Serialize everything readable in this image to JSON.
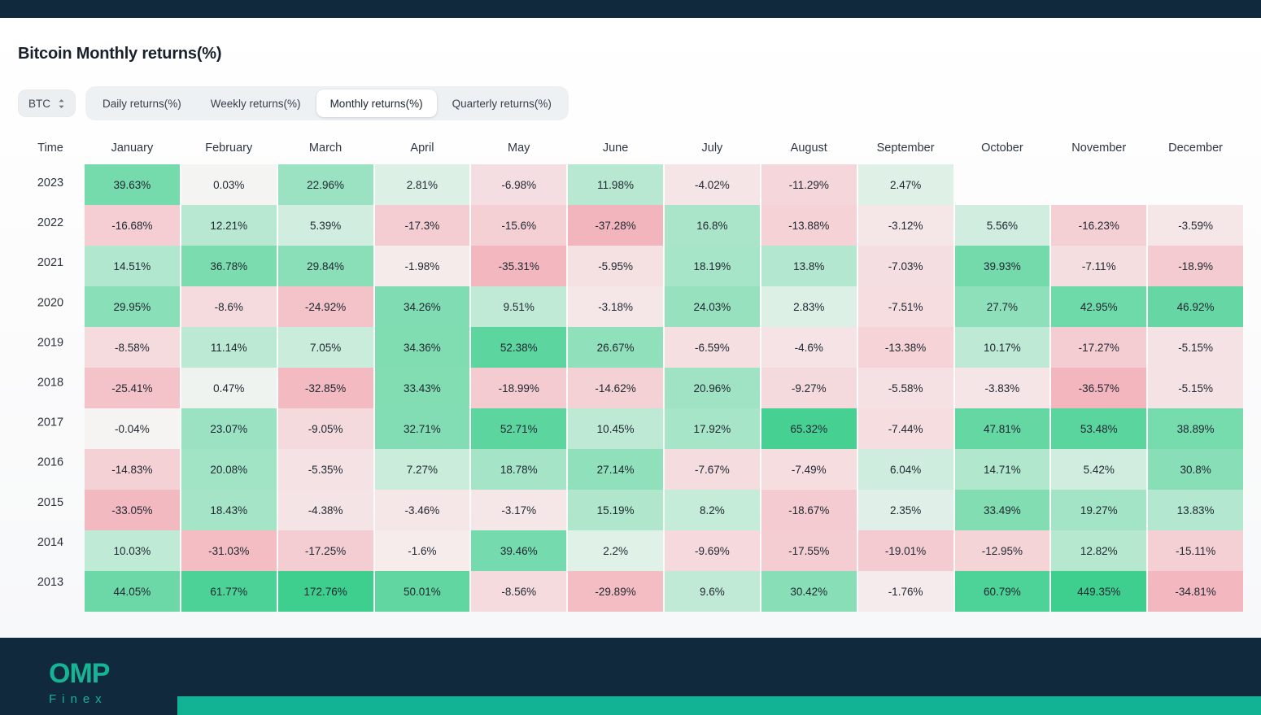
{
  "header": {
    "title": "Bitcoin Monthly returns(%)"
  },
  "controls": {
    "symbol": "BTC",
    "symbol_icon": "chevron-up-down-icon",
    "tabs": [
      {
        "label": "Daily returns(%)",
        "active": false
      },
      {
        "label": "Weekly returns(%)",
        "active": false
      },
      {
        "label": "Monthly returns(%)",
        "active": true
      },
      {
        "label": "Quarterly returns(%)",
        "active": false
      }
    ]
  },
  "colors": {
    "topbar": "#10293d",
    "footer": "#10293d",
    "accent": "#12b394",
    "positive_max": "#3ecf8e",
    "negative_max": "#f3a8b1",
    "neutral": "#f5f4f3",
    "tab_track": "#eef1f4",
    "tab_active": "#ffffff"
  },
  "footer": {
    "logo_primary": "OMP",
    "logo_secondary": "Finex"
  },
  "chart_data": {
    "type": "heatmap",
    "title": "Bitcoin Monthly returns(%)",
    "xlabel": "",
    "ylabel": "Time",
    "row_header": "Time",
    "categories": [
      "January",
      "February",
      "March",
      "April",
      "May",
      "June",
      "July",
      "August",
      "September",
      "October",
      "November",
      "December"
    ],
    "rows": [
      "2023",
      "2022",
      "2021",
      "2020",
      "2019",
      "2018",
      "2017",
      "2016",
      "2015",
      "2014",
      "2013"
    ],
    "unit": "%",
    "values": [
      [
        39.63,
        0.03,
        22.96,
        2.81,
        -6.98,
        11.98,
        -4.02,
        -11.29,
        2.47,
        null,
        null,
        null
      ],
      [
        -16.68,
        12.21,
        5.39,
        -17.3,
        -15.6,
        -37.28,
        16.8,
        -13.88,
        -3.12,
        5.56,
        -16.23,
        -3.59
      ],
      [
        14.51,
        36.78,
        29.84,
        -1.98,
        -35.31,
        -5.95,
        18.19,
        13.8,
        -7.03,
        39.93,
        -7.11,
        -18.9
      ],
      [
        29.95,
        -8.6,
        -24.92,
        34.26,
        9.51,
        -3.18,
        24.03,
        2.83,
        -7.51,
        27.7,
        42.95,
        46.92
      ],
      [
        -8.58,
        11.14,
        7.05,
        34.36,
        52.38,
        26.67,
        -6.59,
        -4.6,
        -13.38,
        10.17,
        -17.27,
        -5.15
      ],
      [
        -25.41,
        0.47,
        -32.85,
        33.43,
        -18.99,
        -14.62,
        20.96,
        -9.27,
        -5.58,
        -3.83,
        -36.57,
        -5.15
      ],
      [
        -0.04,
        23.07,
        -9.05,
        32.71,
        52.71,
        10.45,
        17.92,
        65.32,
        -7.44,
        47.81,
        53.48,
        38.89
      ],
      [
        -14.83,
        20.08,
        -5.35,
        7.27,
        18.78,
        27.14,
        -7.67,
        -7.49,
        6.04,
        14.71,
        5.42,
        30.8
      ],
      [
        -33.05,
        18.43,
        -4.38,
        -3.46,
        -3.17,
        15.19,
        8.2,
        -18.67,
        2.35,
        33.49,
        19.27,
        13.83
      ],
      [
        10.03,
        -31.03,
        -17.25,
        -1.6,
        39.46,
        2.2,
        -9.69,
        -17.55,
        -19.01,
        -12.95,
        12.82,
        -15.11
      ],
      [
        44.05,
        61.77,
        172.76,
        50.01,
        -8.56,
        -29.89,
        9.6,
        30.42,
        -1.76,
        60.79,
        449.35,
        -34.81
      ]
    ],
    "labels": [
      [
        "39.63%",
        "0.03%",
        "22.96%",
        "2.81%",
        "-6.98%",
        "11.98%",
        "-4.02%",
        "-11.29%",
        "2.47%",
        "",
        "",
        ""
      ],
      [
        "-16.68%",
        "12.21%",
        "5.39%",
        "-17.3%",
        "-15.6%",
        "-37.28%",
        "16.8%",
        "-13.88%",
        "-3.12%",
        "5.56%",
        "-16.23%",
        "-3.59%"
      ],
      [
        "14.51%",
        "36.78%",
        "29.84%",
        "-1.98%",
        "-35.31%",
        "-5.95%",
        "18.19%",
        "13.8%",
        "-7.03%",
        "39.93%",
        "-7.11%",
        "-18.9%"
      ],
      [
        "29.95%",
        "-8.6%",
        "-24.92%",
        "34.26%",
        "9.51%",
        "-3.18%",
        "24.03%",
        "2.83%",
        "-7.51%",
        "27.7%",
        "42.95%",
        "46.92%"
      ],
      [
        "-8.58%",
        "11.14%",
        "7.05%",
        "34.36%",
        "52.38%",
        "26.67%",
        "-6.59%",
        "-4.6%",
        "-13.38%",
        "10.17%",
        "-17.27%",
        "-5.15%"
      ],
      [
        "-25.41%",
        "0.47%",
        "-32.85%",
        "33.43%",
        "-18.99%",
        "-14.62%",
        "20.96%",
        "-9.27%",
        "-5.58%",
        "-3.83%",
        "-36.57%",
        "-5.15%"
      ],
      [
        "-0.04%",
        "23.07%",
        "-9.05%",
        "32.71%",
        "52.71%",
        "10.45%",
        "17.92%",
        "65.32%",
        "-7.44%",
        "47.81%",
        "53.48%",
        "38.89%"
      ],
      [
        "-14.83%",
        "20.08%",
        "-5.35%",
        "7.27%",
        "18.78%",
        "27.14%",
        "-7.67%",
        "-7.49%",
        "6.04%",
        "14.71%",
        "5.42%",
        "30.8%"
      ],
      [
        "-33.05%",
        "18.43%",
        "-4.38%",
        "-3.46%",
        "-3.17%",
        "15.19%",
        "8.2%",
        "-18.67%",
        "2.35%",
        "33.49%",
        "19.27%",
        "13.83%"
      ],
      [
        "10.03%",
        "-31.03%",
        "-17.25%",
        "-1.6%",
        "39.46%",
        "2.2%",
        "-9.69%",
        "-17.55%",
        "-19.01%",
        "-12.95%",
        "12.82%",
        "-15.11%"
      ],
      [
        "44.05%",
        "61.77%",
        "172.76%",
        "50.01%",
        "-8.56%",
        "-29.89%",
        "9.6%",
        "30.42%",
        "-1.76%",
        "60.79%",
        "449.35%",
        "-34.81%"
      ]
    ]
  }
}
